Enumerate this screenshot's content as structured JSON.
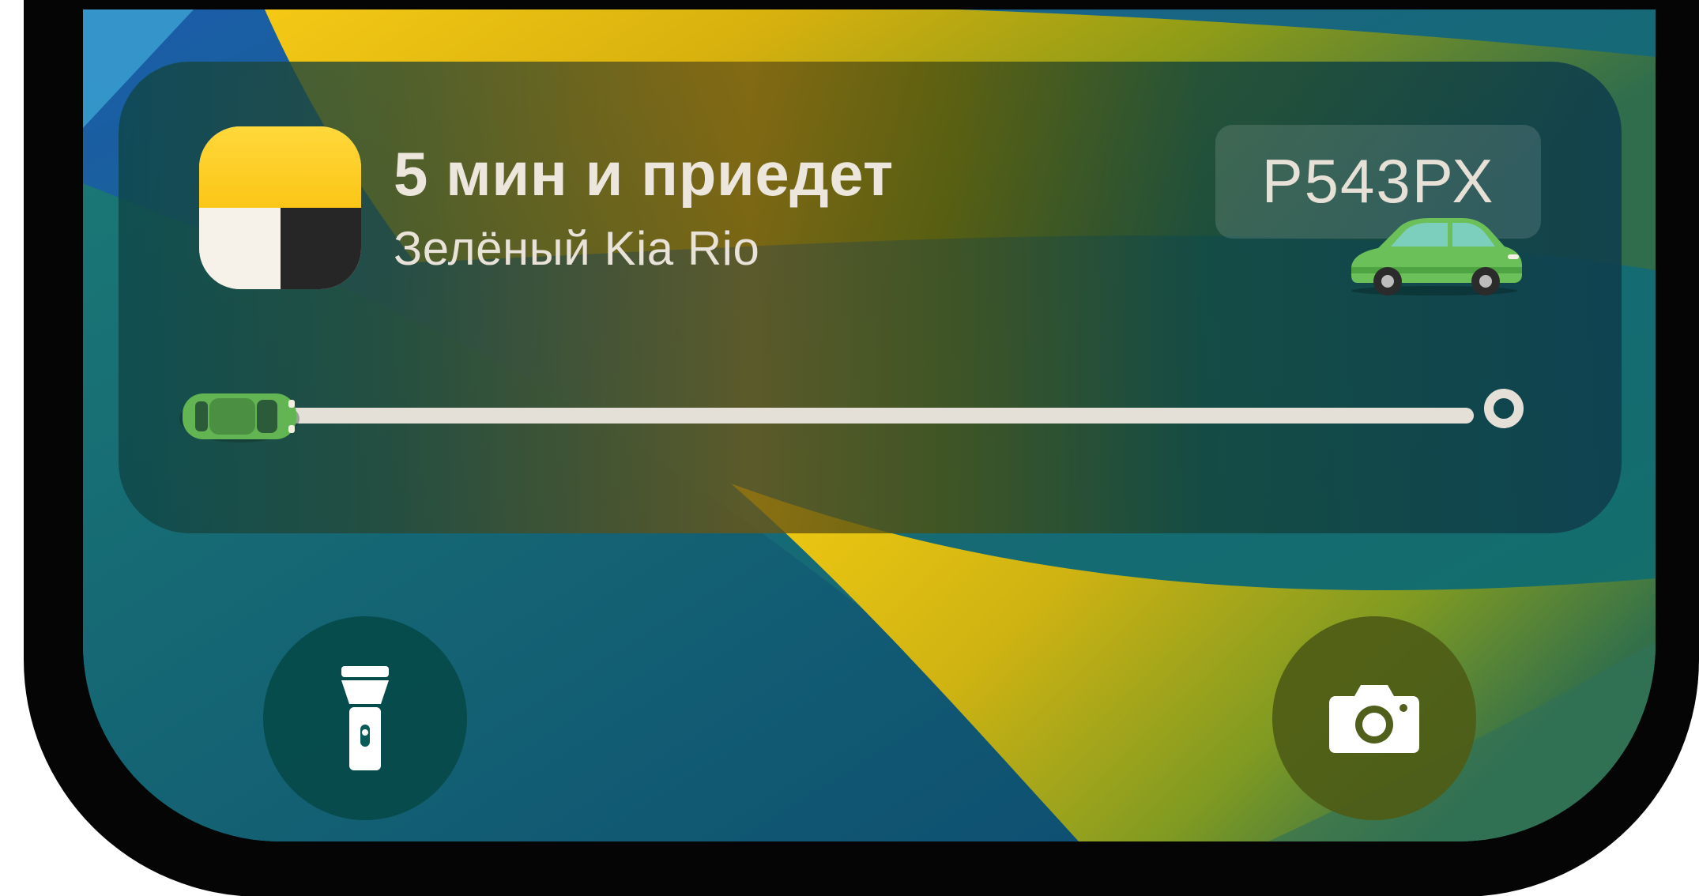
{
  "live_activity": {
    "app_icon": "yandex-go-taxi-icon",
    "eta_title": "5 мин и приедет",
    "car_description": "Зелёный Kia Rio",
    "plate_number": "Р543РХ",
    "car_icon": "green-car-side-icon",
    "progress": {
      "marker_icon": "green-car-top-icon",
      "end_icon": "destination-ring-icon",
      "fraction": 0.0
    }
  },
  "quick_actions": {
    "flashlight_icon": "flashlight-icon",
    "camera_icon": "camera-icon"
  },
  "colors": {
    "wallpaper_blue": "#1a5aa8",
    "wallpaper_teal": "#126a6c",
    "wallpaper_yellow": "#f2c316",
    "app_icon_yellow": "#fbc617",
    "app_icon_black": "#262626",
    "car_green": "#5fb64e",
    "text_light": "#ece6dc"
  }
}
